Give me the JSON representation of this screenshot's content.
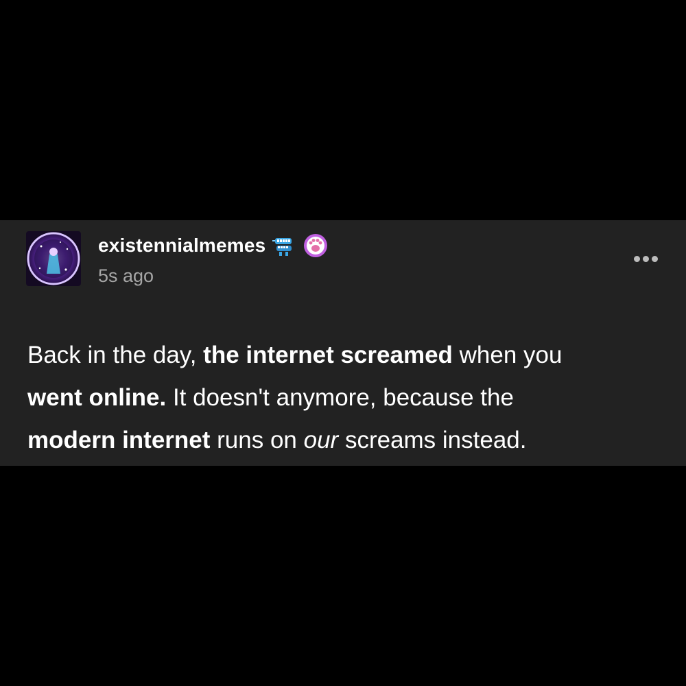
{
  "post": {
    "username": "existennialmemes",
    "timestamp": "5s ago",
    "avatar_icon": "avatar-purple-sparkle",
    "badges": [
      {
        "icon": "chattering-teeth-icon",
        "color": "#3aa7e6"
      },
      {
        "icon": "cat-paw-icon",
        "color": "#c060e0"
      }
    ],
    "more_icon": "ellipsis-icon",
    "body": {
      "line1": {
        "part1": "Back in the day, ",
        "bold1": "the internet screamed",
        "part2": " when you"
      },
      "line2": {
        "bold1": "went online.",
        "part1": " It doesn't anymore, because the"
      },
      "line3": {
        "bold1": "modern internet",
        "part1": " runs on ",
        "italic1": "our",
        "part2": " screams instead."
      }
    }
  },
  "colors": {
    "page_background": "#000000",
    "card_background": "#222222",
    "text_primary": "#ffffff",
    "text_secondary": "#a6a6a6"
  }
}
